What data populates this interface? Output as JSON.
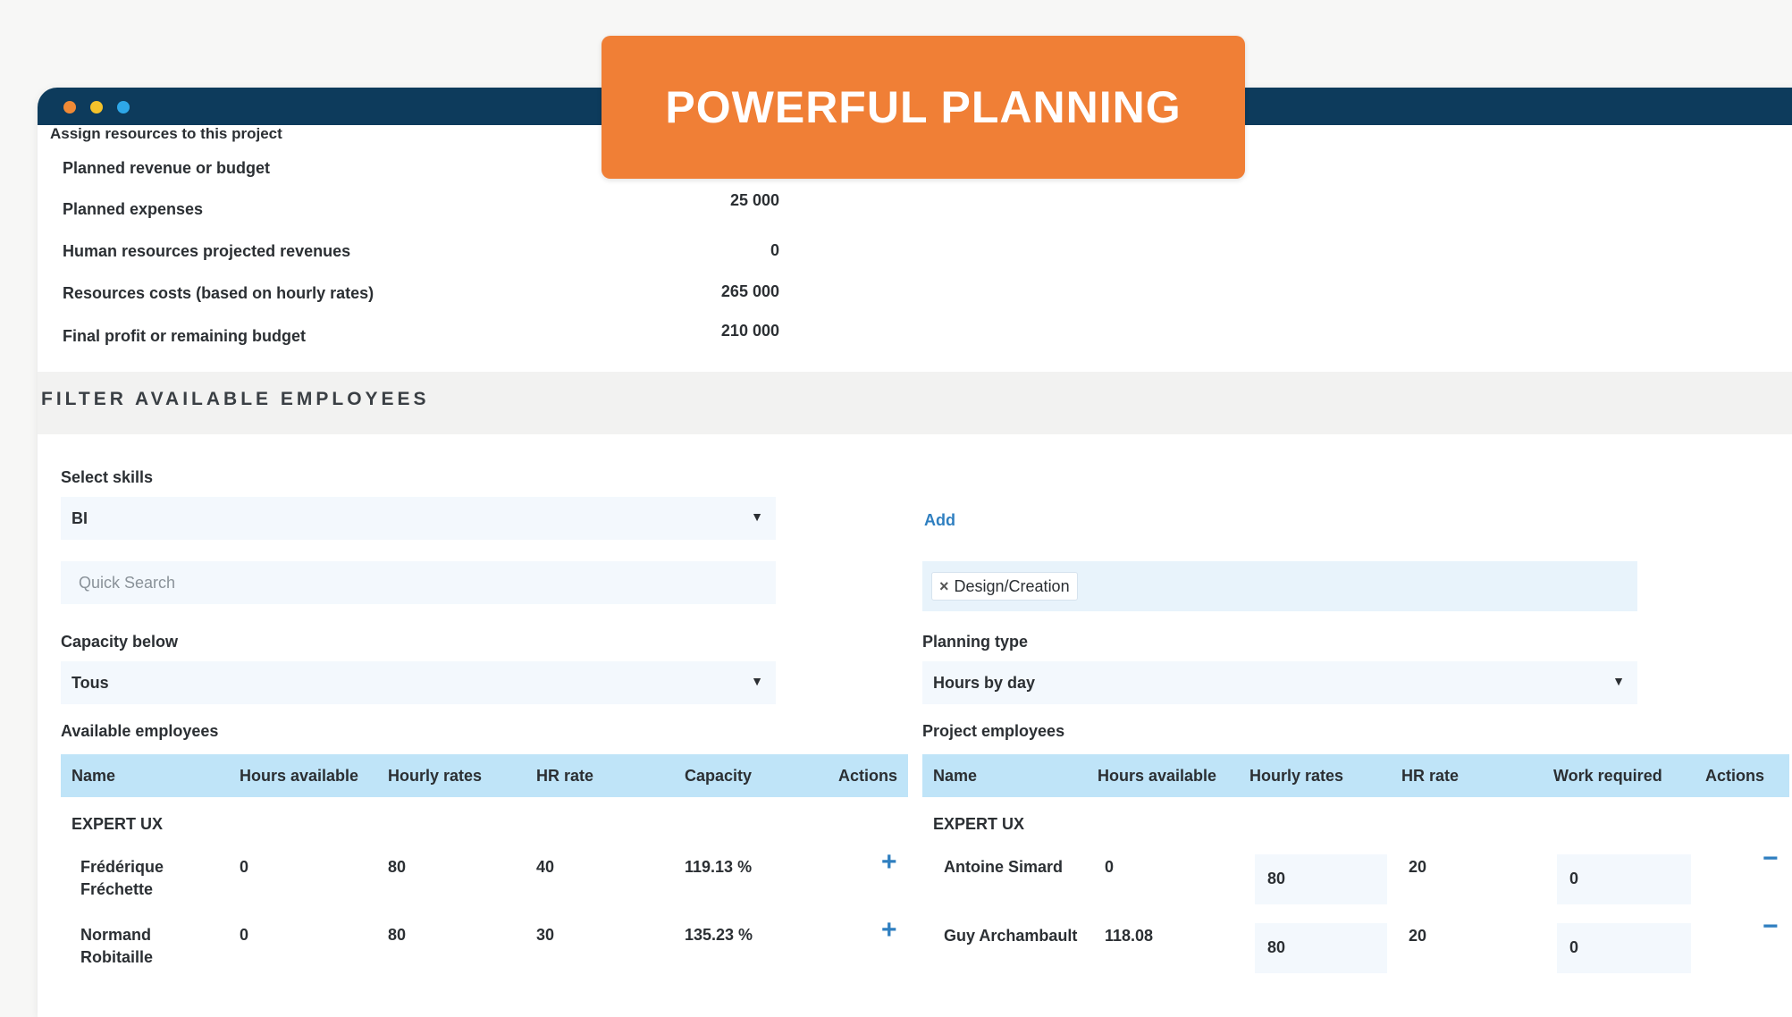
{
  "banner": {
    "text": "POWERFUL PLANNING"
  },
  "colors": {
    "titlebar": "#0d3b5c",
    "banner": "#f07f36",
    "table_header": "#bfe4f8",
    "accent": "#2f7fc0"
  },
  "window": {
    "dots": [
      "orange",
      "yellow",
      "blue"
    ]
  },
  "summary": {
    "heading": "Assign resources to this project",
    "rows": [
      {
        "label": "Planned revenue or budget",
        "value": ""
      },
      {
        "label": "Planned expenses",
        "value": "25 000"
      },
      {
        "label": "Human resources projected revenues",
        "value": "0"
      },
      {
        "label": "Resources costs (based on hourly rates)",
        "value": "265 000"
      },
      {
        "label": "Final profit or remaining budget",
        "value": "210 000"
      }
    ]
  },
  "filter": {
    "title": "FILTER AVAILABLE EMPLOYEES",
    "skills_label": "Select skills",
    "skills_value": "BI",
    "add_label": "Add",
    "quick_search_placeholder": "Quick Search",
    "selected_tag": "Design/Creation",
    "capacity_label": "Capacity below",
    "capacity_value": "Tous",
    "planning_type_label": "Planning type",
    "planning_type_value": "Hours by day"
  },
  "available": {
    "label": "Available employees",
    "columns": [
      "Name",
      "Hours available",
      "Hourly rates",
      "HR rate",
      "Capacity",
      "Actions"
    ],
    "group": "EXPERT UX",
    "rows": [
      {
        "name_l1": "Frédérique",
        "name_l2": "Fréchette",
        "hours": "0",
        "hourly": "80",
        "hr": "40",
        "capacity": "119.13 %"
      },
      {
        "name_l1": "Normand",
        "name_l2": "Robitaille",
        "hours": "0",
        "hourly": "80",
        "hr": "30",
        "capacity": "135.23 %"
      }
    ]
  },
  "project": {
    "label": "Project employees",
    "columns": [
      "Name",
      "Hours available",
      "Hourly rates",
      "HR rate",
      "Work required",
      "Actions"
    ],
    "group": "EXPERT UX",
    "rows": [
      {
        "name": "Antoine Simard",
        "hours": "0",
        "hourly": "80",
        "hr": "20",
        "work": "0"
      },
      {
        "name": "Guy Archambault",
        "hours": "118.08",
        "hourly": "80",
        "hr": "20",
        "work": "0"
      }
    ]
  }
}
